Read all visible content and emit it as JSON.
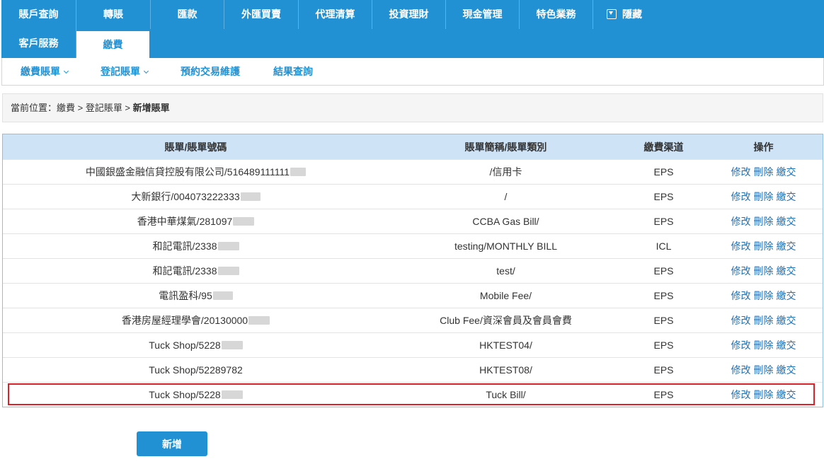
{
  "topnav": {
    "row1": [
      {
        "label": "賬戶查詢",
        "key": "accounts"
      },
      {
        "label": "轉賬",
        "key": "transfer"
      },
      {
        "label": "匯款",
        "key": "remit"
      },
      {
        "label": "外匯買賣",
        "key": "fx"
      },
      {
        "label": "代理清算",
        "key": "clearing"
      },
      {
        "label": "投資理財",
        "key": "invest"
      },
      {
        "label": "現金管理",
        "key": "cash"
      },
      {
        "label": "特色業務",
        "key": "special"
      },
      {
        "label": "隱藏",
        "key": "hide"
      }
    ],
    "row2": [
      {
        "label": "客戶服務",
        "key": "service"
      },
      {
        "label": "繳費",
        "key": "billpay"
      }
    ]
  },
  "subnav": {
    "items": [
      {
        "label": "繳費賬單",
        "dropdown": true
      },
      {
        "label": "登記賬單",
        "dropdown": true
      },
      {
        "label": "預約交易維護",
        "dropdown": false
      },
      {
        "label": "結果查詢",
        "dropdown": false
      }
    ]
  },
  "breadcrumb": {
    "prefix": "當前位置：繳費 > 登記賬單 > ",
    "current": "新增賬單"
  },
  "table": {
    "headers": [
      "賬單/賬單號碼",
      "賬單簡稱/賬單類別",
      "繳費渠道",
      "操作"
    ],
    "rows": [
      {
        "bill": "中國銀盛金融信貸控股有限公司/516489111111",
        "type": "/信用卡",
        "channel": "EPS"
      },
      {
        "bill": "大新銀行/004073222333",
        "type": "/",
        "channel": "EPS"
      },
      {
        "bill": "香港中華煤氣/281097",
        "type": "CCBA Gas Bill/",
        "channel": "EPS"
      },
      {
        "bill": "和記電訊/2338",
        "type": "testing/MONTHLY BILL",
        "channel": "ICL"
      },
      {
        "bill": "和記電訊/2338",
        "type": "test/",
        "channel": "EPS"
      },
      {
        "bill": "電訊盈科/95",
        "type": "Mobile Fee/",
        "channel": "EPS"
      },
      {
        "bill": "香港房屋經理學會/20130000",
        "type": "Club Fee/資深會員及會員會費",
        "channel": "EPS"
      },
      {
        "bill": "Tuck Shop/5228",
        "type": "HKTEST04/",
        "channel": "EPS"
      },
      {
        "bill": "Tuck Shop/52289782",
        "type": "HKTEST08/",
        "channel": "EPS"
      },
      {
        "bill": "Tuck Shop/5228",
        "type": "Tuck Bill/",
        "channel": "EPS"
      }
    ],
    "actions": {
      "edit": "修改",
      "delete": "刪除",
      "pay": "繳交"
    }
  },
  "add_button": "新增"
}
